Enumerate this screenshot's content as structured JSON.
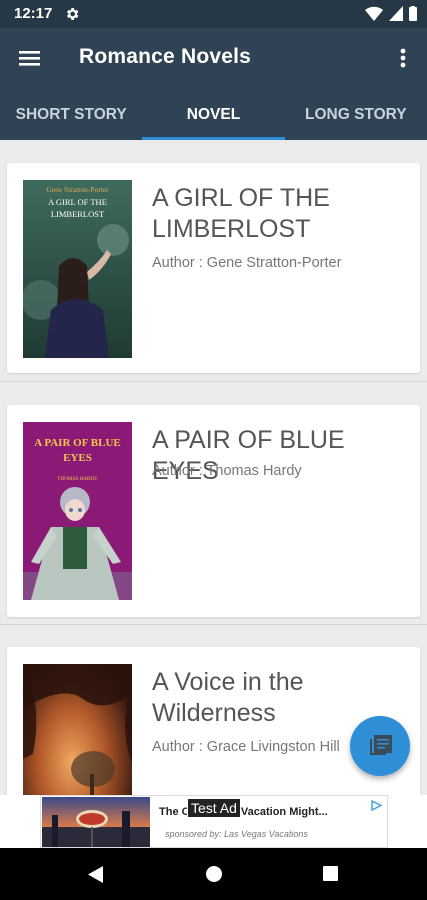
{
  "status_bar": {
    "time": "12:17"
  },
  "app_bar": {
    "title": "Romance Novels"
  },
  "tabs": [
    {
      "label": "SHORT STORY",
      "active": false
    },
    {
      "label": "NOVEL",
      "active": true
    },
    {
      "label": "LONG STORY",
      "active": false
    }
  ],
  "books": [
    {
      "title": "A GIRL OF THE LIMBERLOST",
      "author": "Author : Gene Stratton-Porter",
      "cover_author_text": "Gene Stratton-Porter",
      "cover_title_text": "A GIRL OF THE LIMBERLOST"
    },
    {
      "title": "A PAIR OF BLUE EYES",
      "author": "Author : Thomas Hardy",
      "cover_title_text": "A PAIR OF BLUE EYES",
      "cover_author_text": "THOMAS HARDY"
    },
    {
      "title": "A Voice in the Wilderness",
      "author": "Author : Grace Livingston Hill"
    }
  ],
  "ad": {
    "headline": "The Ot... Vegas Vacation Might...",
    "sponsor": "sponsored by: Las Vegas Vacations",
    "badge": "Test Ad"
  },
  "colors": {
    "app_bar": "#2f4355",
    "status_bar": "#263746",
    "accent": "#2f8fd6"
  },
  "icons": {
    "menu": "hamburger-menu-icon",
    "more": "more-vert-icon",
    "fab": "library-book-icon"
  }
}
